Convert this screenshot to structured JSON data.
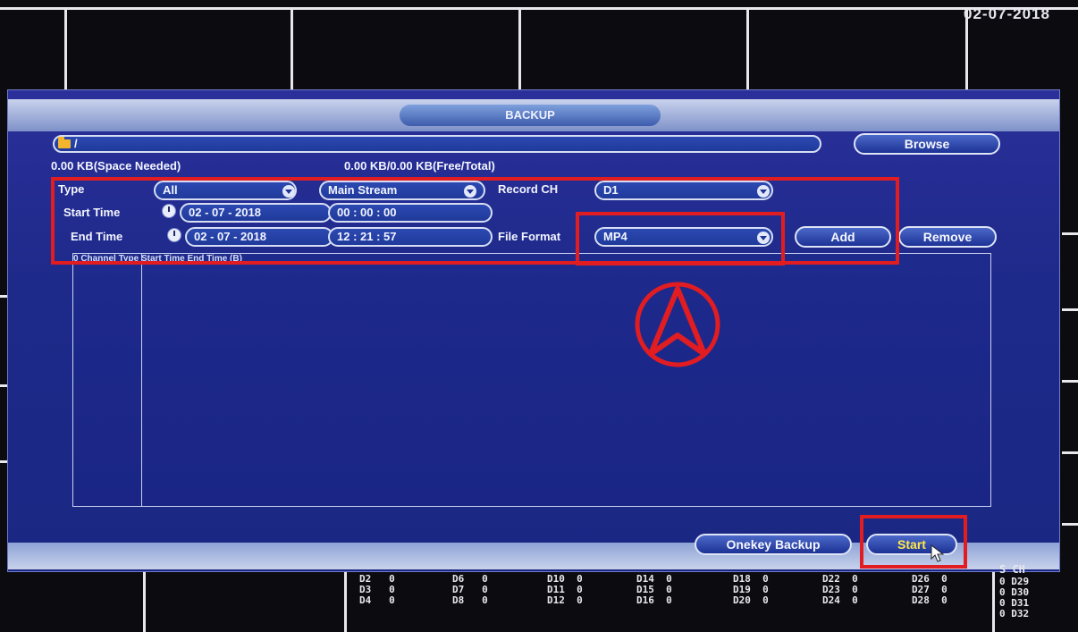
{
  "top_date": "02-07-2018",
  "dialog": {
    "title": "BACKUP",
    "path": "/",
    "browse_label": "Browse",
    "space_needed": "0.00 KB(Space Needed)",
    "free_total": "0.00 KB/0.00 KB(Free/Total)",
    "type_label": "Type",
    "type_value": "All",
    "stream_value": "Main Stream",
    "record_ch_label": "Record CH",
    "record_ch_value": "D1",
    "start_time_label": "Start Time",
    "start_date": "02 - 07 - 2018",
    "start_clock": "00 : 00 : 00",
    "end_time_label": "End Time",
    "end_date": "02 - 07 - 2018",
    "end_clock": "12 : 21 : 57",
    "file_format_label": "File Format",
    "file_format_value": "MP4",
    "add_label": "Add",
    "remove_label": "Remove",
    "list_header": "0     Channel    Type     Start Time                                End Time                              (B)",
    "onekey_label": "Onekey Backup",
    "start_label": "Start"
  },
  "channel_status": {
    "col1": [
      "D2   0",
      "D3   0",
      "D4   0"
    ],
    "col2": [
      "D6   0",
      "D7   0",
      "D8   0"
    ],
    "col3": [
      "D10  0",
      "D11  0",
      "D12  0"
    ],
    "col4": [
      "D14  0",
      "D15  0",
      "D16  0"
    ],
    "col5": [
      "D18  0",
      "D19  0",
      "D20  0"
    ],
    "col6": [
      "D22  0",
      "D23  0",
      "D24  0"
    ],
    "col7": [
      "D26  0",
      "D27  0",
      "D28  0"
    ],
    "head": "S  CH",
    "col8": [
      "0  D29",
      "0  D30",
      "0  D31",
      "0  D32"
    ]
  },
  "colors": {
    "accent_red": "#e11d22",
    "dialog_blue": "#1e2a8a"
  },
  "icons": [
    "folder-icon",
    "clock-icon",
    "dropdown-icon",
    "compass-icon",
    "mouse-cursor-icon"
  ]
}
